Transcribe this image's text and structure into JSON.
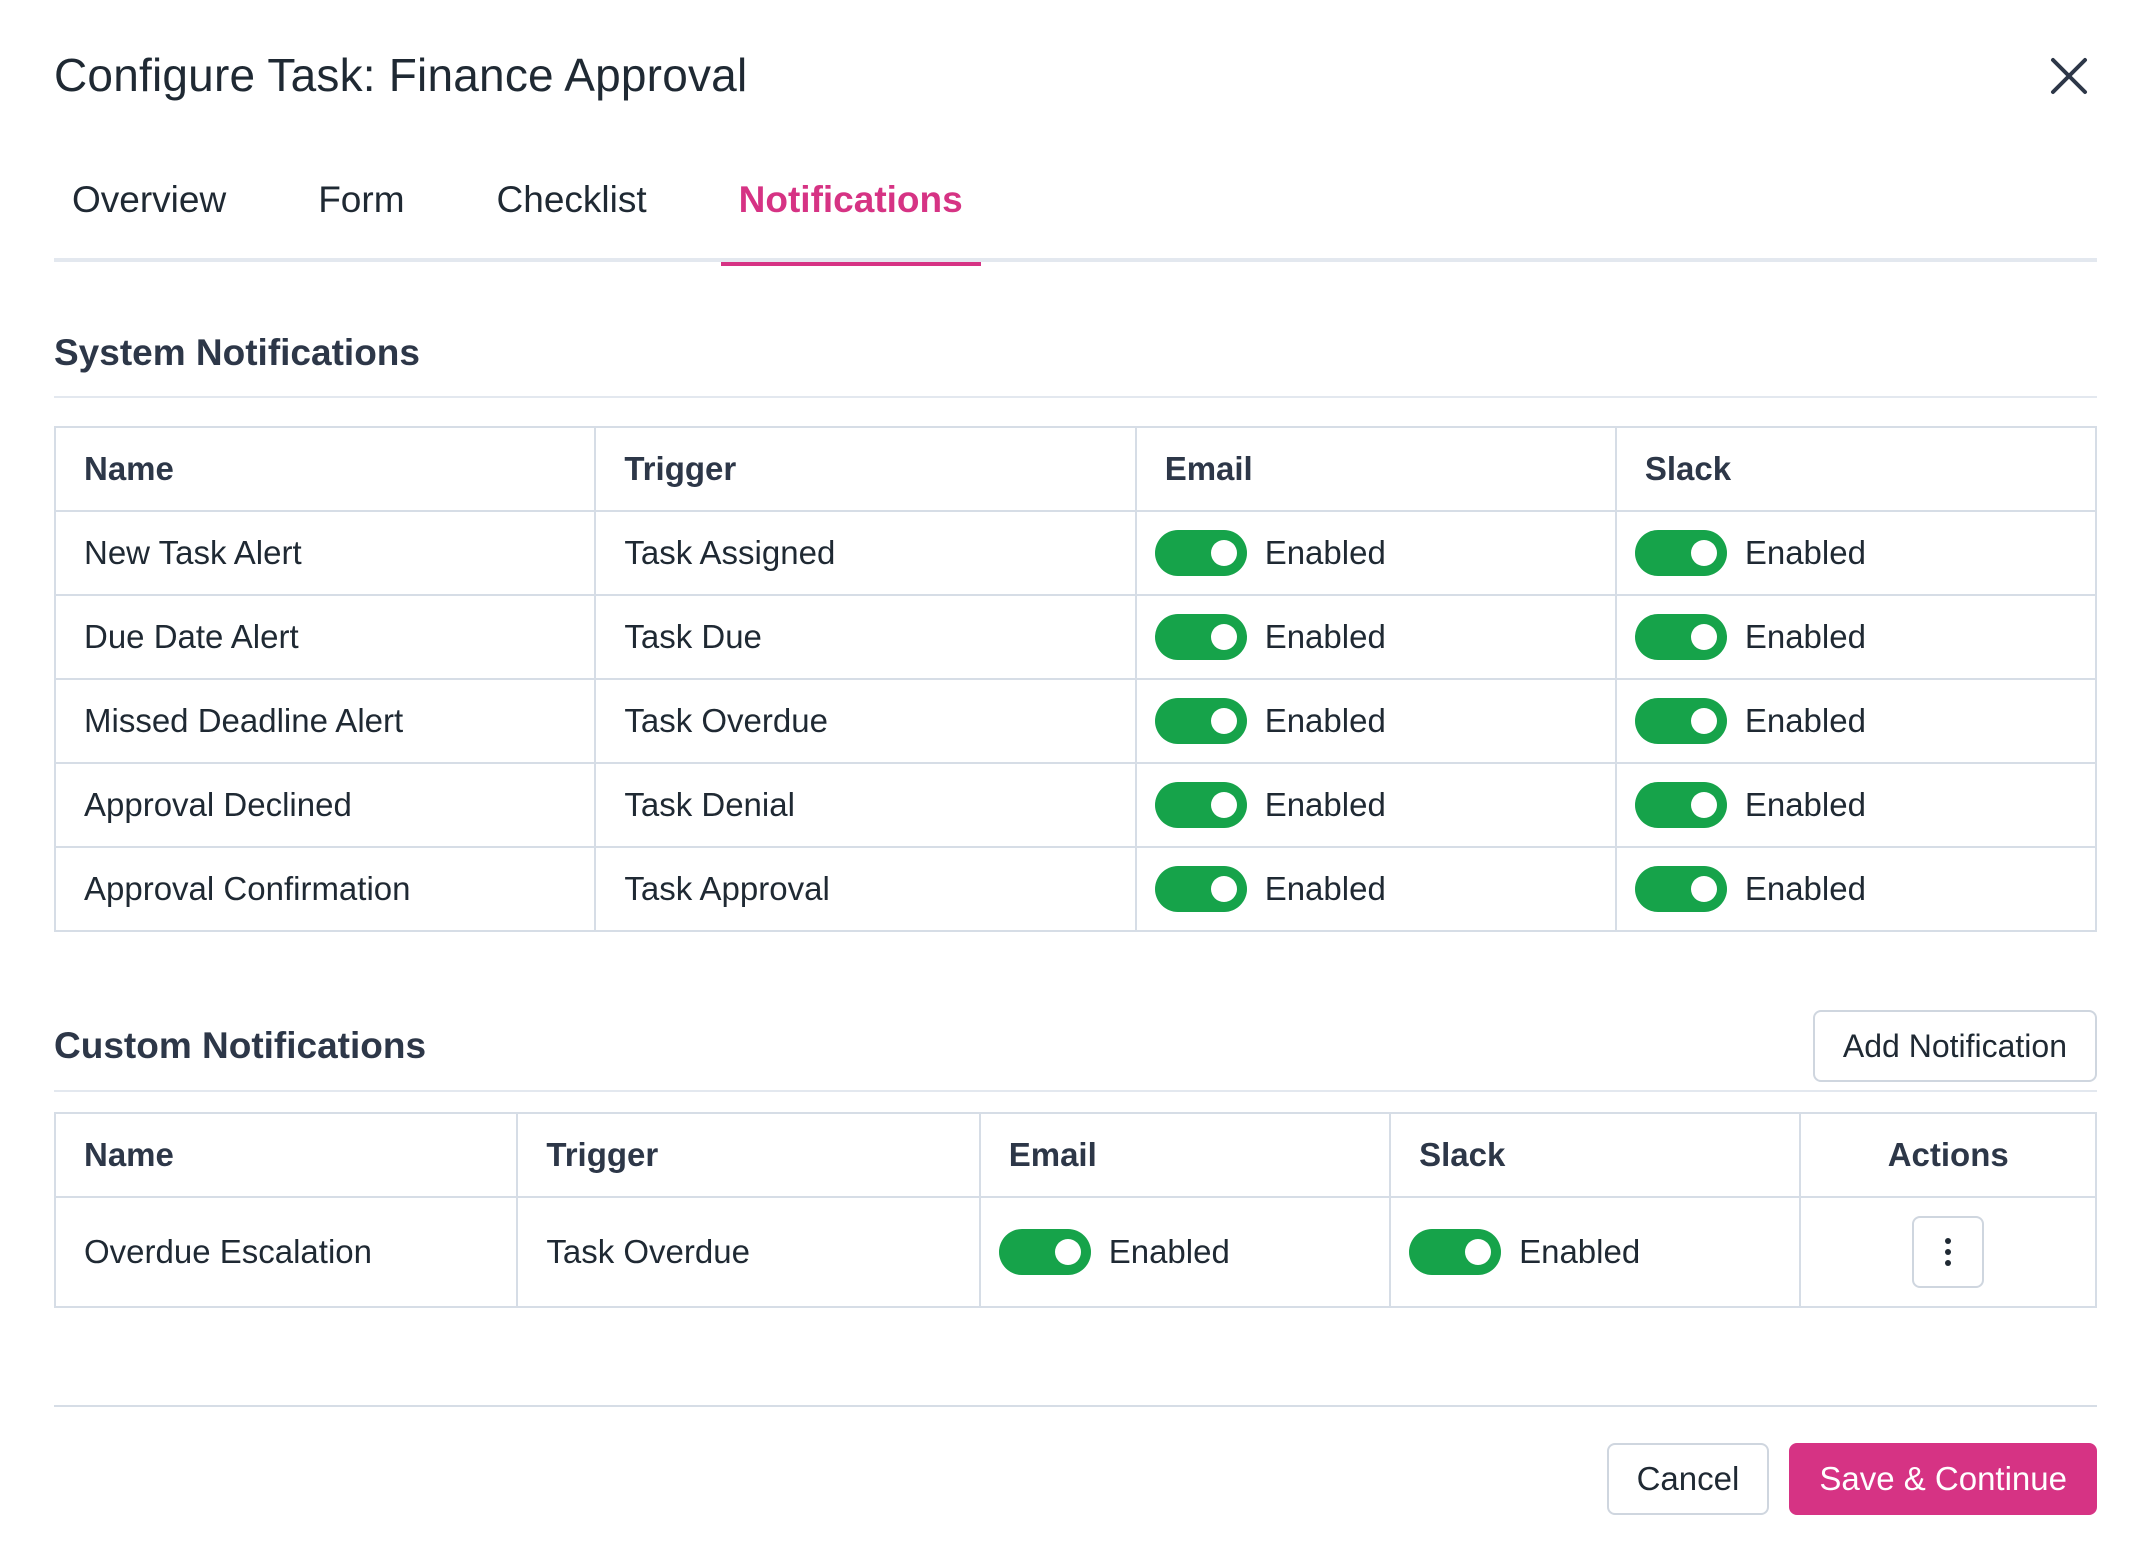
{
  "dialog": {
    "title": "Configure Task: Finance Approval"
  },
  "tabs": [
    {
      "label": "Overview"
    },
    {
      "label": "Form"
    },
    {
      "label": "Checklist"
    },
    {
      "label": "Notifications",
      "active": true
    }
  ],
  "system": {
    "title": "System Notifications",
    "columns": [
      "Name",
      "Trigger",
      "Email",
      "Slack"
    ],
    "rows": [
      {
        "name": "New Task Alert",
        "trigger": "Task Assigned",
        "email": "Enabled",
        "slack": "Enabled"
      },
      {
        "name": "Due Date Alert",
        "trigger": "Task Due",
        "email": "Enabled",
        "slack": "Enabled"
      },
      {
        "name": "Missed Deadline Alert",
        "trigger": "Task Overdue",
        "email": "Enabled",
        "slack": "Enabled"
      },
      {
        "name": "Approval Declined",
        "trigger": "Task Denial",
        "email": "Enabled",
        "slack": "Enabled"
      },
      {
        "name": "Approval Confirmation",
        "trigger": "Task Approval",
        "email": "Enabled",
        "slack": "Enabled"
      }
    ]
  },
  "custom": {
    "title": "Custom Notifications",
    "add_label": "Add Notification",
    "columns": [
      "Name",
      "Trigger",
      "Email",
      "Slack",
      "Actions"
    ],
    "rows": [
      {
        "name": "Overdue Escalation",
        "trigger": "Task Overdue",
        "email": "Enabled",
        "slack": "Enabled"
      }
    ]
  },
  "footer": {
    "cancel_label": "Cancel",
    "save_label": "Save & Continue"
  },
  "colors": {
    "accent": "#d63384",
    "toggle_on": "#16a34a",
    "border": "#d6dde6"
  },
  "icons": {
    "close": "close-icon",
    "actions": "kebab-menu-icon",
    "toggle": "toggle-switch"
  }
}
